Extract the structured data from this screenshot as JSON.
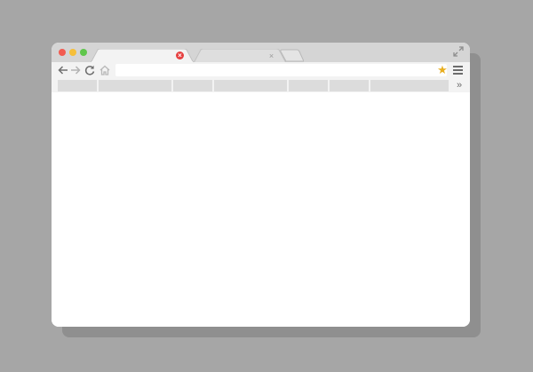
{
  "window": {
    "controls": [
      "close",
      "minimize",
      "maximize"
    ],
    "expand_icon": "expand-icon"
  },
  "tabs": [
    {
      "label": "",
      "active": true,
      "close_icon": "close-icon",
      "close_color": "#e64040"
    },
    {
      "label": "",
      "active": false,
      "close_icon": "close-icon"
    }
  ],
  "toolbar": {
    "address": {
      "value": "",
      "placeholder": ""
    },
    "icons": [
      "back-arrow-icon",
      "forward-arrow-icon",
      "reload-icon",
      "home-icon",
      "star-icon",
      "hamburger-menu-icon"
    ],
    "star_color": "#e8ae1f"
  },
  "bookmarks_bar": {
    "items": [
      "",
      "",
      "",
      "",
      "",
      "",
      "",
      ""
    ],
    "overflow_icon": "chevron-double-right-icon"
  },
  "colors": {
    "background": "#a6a6a6",
    "titlebar": "#d5d5d5",
    "toolbar": "#f3f3f3",
    "bookmark": "#dcdcdc",
    "close": "#f25b50",
    "minimize": "#f6bf3a",
    "maximize": "#5fc64b"
  }
}
